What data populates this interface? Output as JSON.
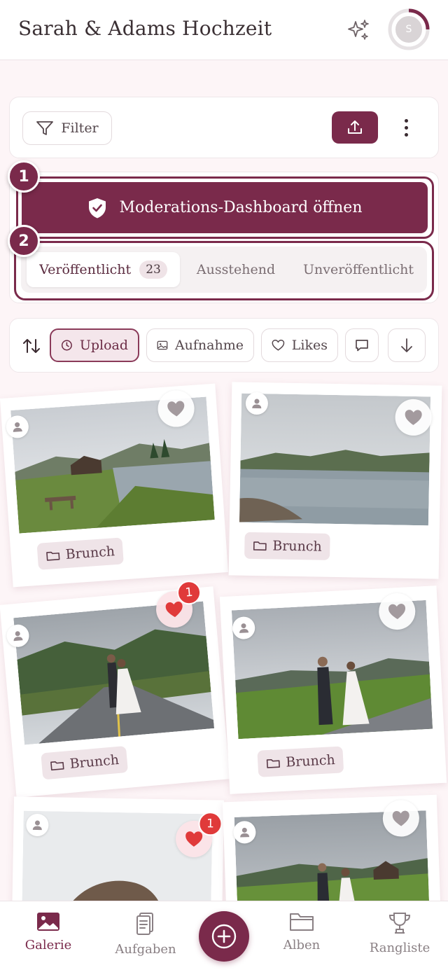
{
  "header": {
    "title": "Sarah & Adams Hochzeit",
    "avatar_initial": "S"
  },
  "toolbar": {
    "filter_label": "Filter"
  },
  "moderation": {
    "button_label": "Moderations-Dashboard öffnen",
    "step1": "1",
    "step2": "2"
  },
  "tabs": [
    {
      "label": "Veröffentlicht",
      "count": "23"
    },
    {
      "label": "Ausstehend"
    },
    {
      "label": "Unveröffentlicht"
    }
  ],
  "sort": {
    "chips": [
      "Upload",
      "Aufnahme",
      "Likes"
    ]
  },
  "gallery": {
    "items": [
      {
        "album": "Brunch",
        "liked": false
      },
      {
        "album": "Brunch",
        "liked": false
      },
      {
        "album": "Brunch",
        "liked": true,
        "likes": "1"
      },
      {
        "album": "Brunch",
        "liked": false
      },
      {
        "liked": true,
        "likes": "1"
      },
      {
        "liked": false
      }
    ]
  },
  "nav": {
    "items": [
      "Galerie",
      "Aufgaben",
      "Alben",
      "Rangliste"
    ]
  },
  "colors": {
    "accent": "#7a2a4b",
    "like": "#e03a3a"
  }
}
